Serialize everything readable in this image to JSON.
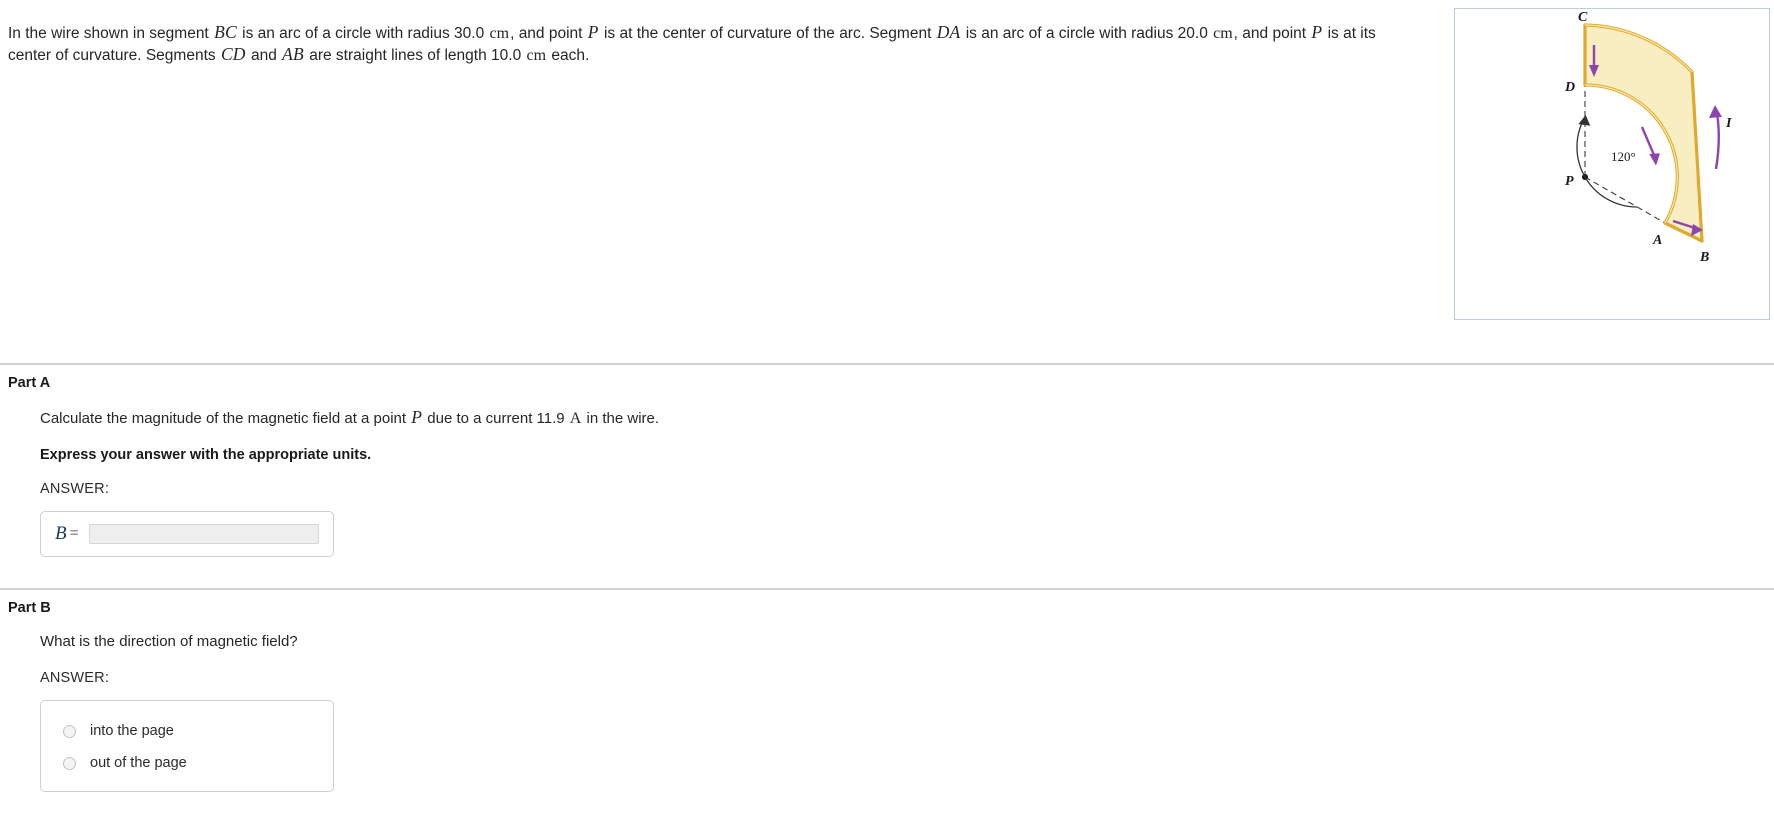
{
  "problem": {
    "text_parts": [
      {
        "t": "In the wire shown in segment ",
        "k": "plain"
      },
      {
        "t": "BC",
        "k": "var"
      },
      {
        "t": " is an arc of a circle with radius 30.0 ",
        "k": "plain"
      },
      {
        "t": "cm",
        "k": "unit"
      },
      {
        "t": ", and point ",
        "k": "plain"
      },
      {
        "t": "P",
        "k": "var"
      },
      {
        "t": " is at the center of curvature of the arc. Segment ",
        "k": "plain"
      },
      {
        "t": "DA",
        "k": "var"
      },
      {
        "t": " is an arc of a circle with radius 20.0 ",
        "k": "plain"
      },
      {
        "t": "cm",
        "k": "unit"
      },
      {
        "t": ", and point ",
        "k": "plain"
      },
      {
        "t": "P",
        "k": "var"
      },
      {
        "t": " is at its center of curvature. Segments ",
        "k": "plain"
      },
      {
        "t": "CD",
        "k": "var"
      },
      {
        "t": " and ",
        "k": "plain"
      },
      {
        "t": "AB",
        "k": "var"
      },
      {
        "t": " are straight lines of length 10.0 ",
        "k": "plain"
      },
      {
        "t": "cm",
        "k": "unit"
      },
      {
        "t": " each.",
        "k": "plain"
      }
    ],
    "outer_radius": "30.0 cm",
    "inner_radius": "20.0 cm",
    "straight_length": "10.0 cm"
  },
  "figure": {
    "labels": {
      "point_c": "C",
      "point_d": "D",
      "point_p": "P",
      "point_a": "A",
      "point_b": "B",
      "current": "I",
      "angle": "120°"
    },
    "colors": {
      "wire": "#e3b23c",
      "wire_fill": "#f6e3a8",
      "arrow": "#8e44ad",
      "dashed": "#4a4a4a",
      "border": "#b9cddc"
    }
  },
  "parts": [
    {
      "id": "A",
      "title": "Part A",
      "prompt_parts": [
        {
          "t": "Calculate the magnitude of the magnetic field at a point ",
          "k": "plain"
        },
        {
          "t": "P",
          "k": "var"
        },
        {
          "t": " due to a current 11.9 ",
          "k": "plain"
        },
        {
          "t": "A",
          "k": "unit"
        },
        {
          "t": " in the wire.",
          "k": "plain"
        }
      ],
      "instruction": "Express your answer with the appropriate units.",
      "answer_label": "ANSWER:",
      "field_symbol": "B",
      "field_equals": "=",
      "field_value": "",
      "current": "11.9 A"
    },
    {
      "id": "B",
      "title": "Part B",
      "prompt_parts": [
        {
          "t": "What is the direction of magnetic field?",
          "k": "plain"
        }
      ],
      "answer_label": "ANSWER:",
      "options": [
        {
          "label": "into the page",
          "selected": false
        },
        {
          "label": "out of the page",
          "selected": false
        }
      ]
    }
  ]
}
